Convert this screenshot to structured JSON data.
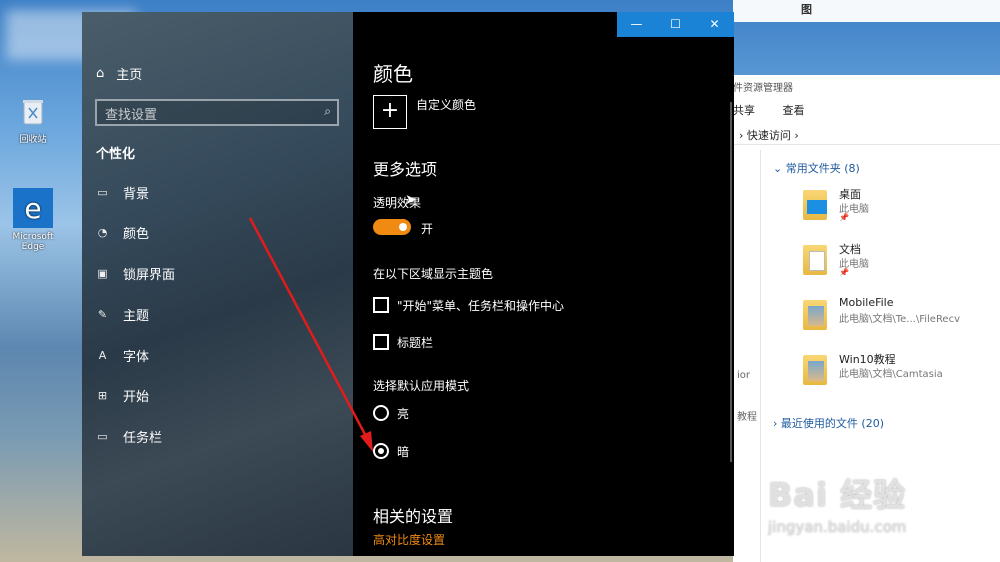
{
  "desktop": {
    "recycle_label": "回收站",
    "edge_label": "Microsoft Edge",
    "top_partial": "图"
  },
  "explorer": {
    "title": "件资源管理器",
    "ribbon": [
      "共享",
      "查看"
    ],
    "address": "› 快速访问 ›",
    "nav_fragments": [
      "ior",
      "教程"
    ],
    "frequent_header": "常用文件夹 (8)",
    "folders": [
      {
        "name": "桌面",
        "path": "此电脑"
      },
      {
        "name": "文档",
        "path": "此电脑"
      },
      {
        "name": "MobileFile",
        "path": "此电脑\\文档\\Te...\\FileRecv"
      },
      {
        "name": "Win10教程",
        "path": "此电脑\\文档\\Camtasia"
      }
    ],
    "recent_header": "最近使用的文件 (20)"
  },
  "settings": {
    "window_controls": {
      "minimize": "—",
      "maximize": "☐",
      "close": "✕"
    },
    "sidebar": {
      "home": "主页",
      "search_placeholder": "查找设置",
      "section": "个性化",
      "items": [
        {
          "label": "背景",
          "icon": "picture-icon"
        },
        {
          "label": "颜色",
          "icon": "palette-icon"
        },
        {
          "label": "锁屏界面",
          "icon": "lockscreen-icon"
        },
        {
          "label": "主题",
          "icon": "theme-icon"
        },
        {
          "label": "字体",
          "icon": "font-icon"
        },
        {
          "label": "开始",
          "icon": "start-icon"
        },
        {
          "label": "任务栏",
          "icon": "taskbar-icon"
        }
      ]
    },
    "content": {
      "heading": "颜色",
      "custom_color": "自定义颜色",
      "more_options": "更多选项",
      "transparency_label": "透明效果",
      "transparency_state": "开",
      "show_accent_label": "在以下区域显示主题色",
      "check_start": "\"开始\"菜单、任务栏和操作中心",
      "check_titlebar": "标题栏",
      "app_mode_label": "选择默认应用模式",
      "mode_light": "亮",
      "mode_dark": "暗",
      "related": "相关的设置",
      "link_high_contrast": "高对比度设置"
    },
    "accent_color": "#f08a12",
    "titlebar_color": "#1a83d6"
  },
  "watermark": {
    "main": "Bai 经验",
    "sub": "jingyan.baidu.com"
  }
}
